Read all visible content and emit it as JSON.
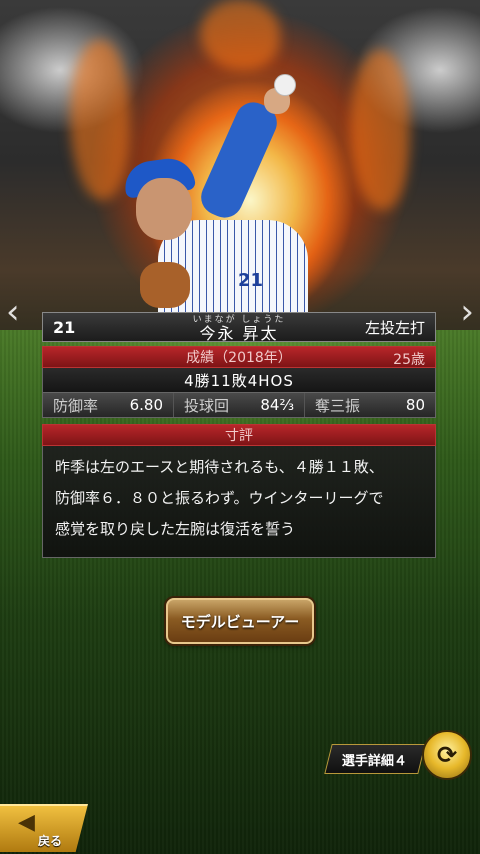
{
  "player": {
    "number": "21",
    "name": "今永 昇太",
    "ruby": "いまなが しょうた",
    "hand_type": "左投左打",
    "uniform_number": "21"
  },
  "record": {
    "header": "成績（2018年）",
    "age": "25歳",
    "summary": "4勝11敗4HOS",
    "stats": [
      {
        "label": "防御率",
        "value": "6.80"
      },
      {
        "label": "投球回",
        "value": "84⅔"
      },
      {
        "label": "奪三振",
        "value": "80"
      }
    ]
  },
  "review": {
    "header": "寸評",
    "lines": [
      "昨季は左のエースと期待されるも、４勝１１敗、",
      "防御率６．８０と振るわず。ウインターリーグで",
      "感覚を取り戻した左腕は復活を誓う"
    ]
  },
  "buttons": {
    "model_viewer": "モデルビューアー",
    "player_detail": "選手詳細４",
    "back": "戻る"
  },
  "icons": {
    "prev": "chevron-left-icon",
    "next": "chevron-right-icon",
    "swap": "swap-icon",
    "back": "back-arrow-icon"
  }
}
